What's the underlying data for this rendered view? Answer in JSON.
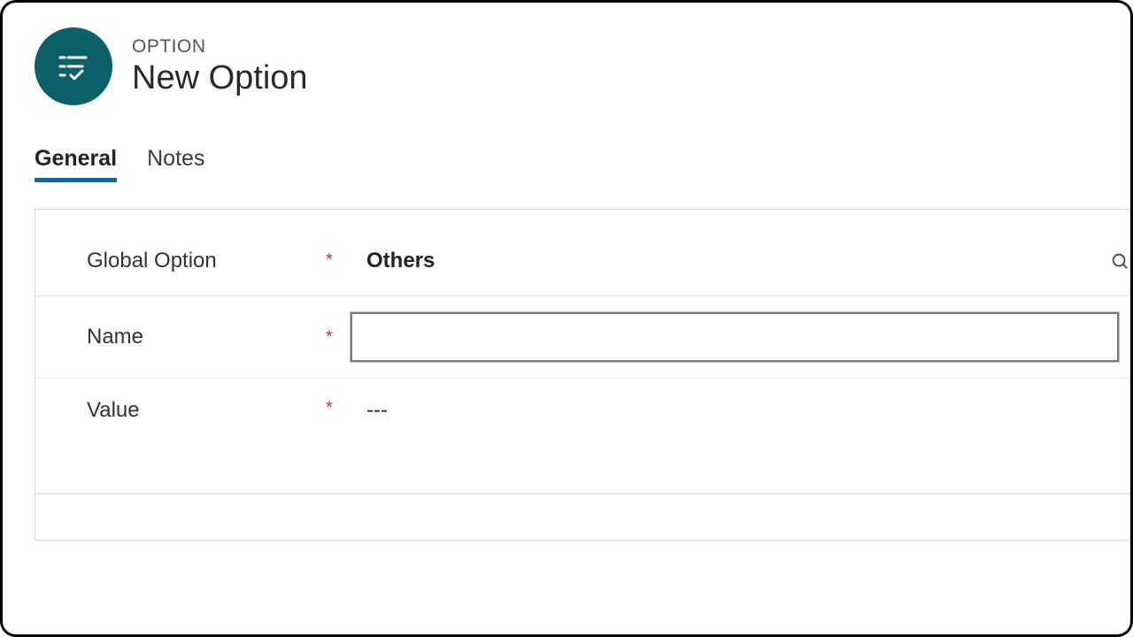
{
  "header": {
    "entity_type": "OPTION",
    "title": "New Option",
    "icon": "list-check-icon"
  },
  "tabs": [
    {
      "label": "General",
      "active": true
    },
    {
      "label": "Notes",
      "active": false
    }
  ],
  "form": {
    "global_option": {
      "label": "Global Option",
      "required": true,
      "value": "Others"
    },
    "name": {
      "label": "Name",
      "required": true,
      "value": ""
    },
    "value_field": {
      "label": "Value",
      "required": true,
      "value": "---"
    }
  }
}
